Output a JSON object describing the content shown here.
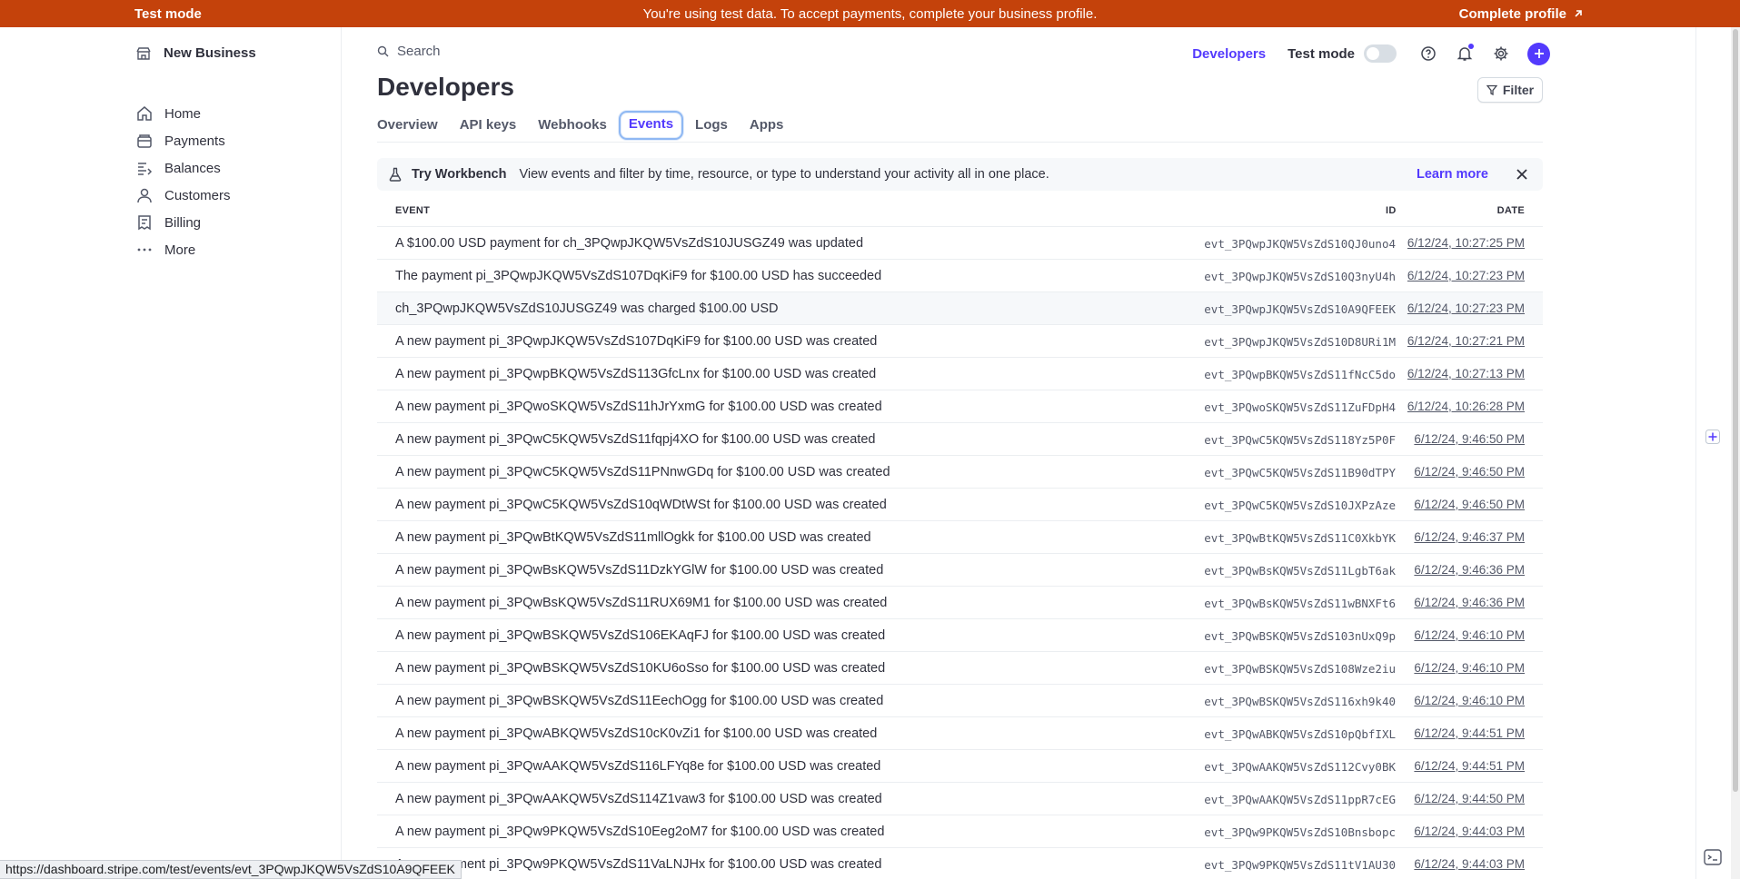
{
  "banner": {
    "left": "Test mode",
    "center": "You're using test data. To accept payments, complete your business profile.",
    "right": "Complete profile"
  },
  "sidebar": {
    "business": "New Business",
    "items": [
      {
        "label": "Home",
        "icon": "home-icon"
      },
      {
        "label": "Payments",
        "icon": "payments-icon"
      },
      {
        "label": "Balances",
        "icon": "balances-icon"
      },
      {
        "label": "Customers",
        "icon": "customers-icon"
      },
      {
        "label": "Billing",
        "icon": "billing-icon"
      },
      {
        "label": "More",
        "icon": "more-icon"
      }
    ]
  },
  "topbar": {
    "search_placeholder": "Search",
    "developers": "Developers",
    "test_mode": "Test mode"
  },
  "page": {
    "title": "Developers",
    "filter": "Filter",
    "tabs": [
      "Overview",
      "API keys",
      "Webhooks",
      "Events",
      "Logs",
      "Apps"
    ],
    "active_tab": "Events"
  },
  "notice": {
    "title": "Try Workbench",
    "text": "View events and filter by time, resource, or type to understand your activity all in one place.",
    "link": "Learn more"
  },
  "table": {
    "headers": {
      "event": "EVENT",
      "id": "ID",
      "date": "DATE"
    },
    "rows": [
      {
        "event": "A $100.00 USD payment for ch_3PQwpJKQW5VsZdS10JUSGZ49 was updated",
        "id": "evt_3PQwpJKQW5VsZdS10QJ0uno4",
        "date": "6/12/24, 10:27:25 PM"
      },
      {
        "event": "The payment pi_3PQwpJKQW5VsZdS107DqKiF9 for $100.00 USD has succeeded",
        "id": "evt_3PQwpJKQW5VsZdS10Q3nyU4h",
        "date": "6/12/24, 10:27:23 PM"
      },
      {
        "event": "ch_3PQwpJKQW5VsZdS10JUSGZ49 was charged $100.00 USD",
        "id": "evt_3PQwpJKQW5VsZdS10A9QFEEK",
        "date": "6/12/24, 10:27:23 PM"
      },
      {
        "event": "A new payment pi_3PQwpJKQW5VsZdS107DqKiF9 for $100.00 USD was created",
        "id": "evt_3PQwpJKQW5VsZdS10D8URi1M",
        "date": "6/12/24, 10:27:21 PM"
      },
      {
        "event": "A new payment pi_3PQwpBKQW5VsZdS113GfcLnx for $100.00 USD was created",
        "id": "evt_3PQwpBKQW5VsZdS11fNcC5do",
        "date": "6/12/24, 10:27:13 PM"
      },
      {
        "event": "A new payment pi_3PQwoSKQW5VsZdS11hJrYxmG for $100.00 USD was created",
        "id": "evt_3PQwoSKQW5VsZdS11ZuFDpH4",
        "date": "6/12/24, 10:26:28 PM"
      },
      {
        "event": "A new payment pi_3PQwC5KQW5VsZdS11fqpj4XO for $100.00 USD was created",
        "id": "evt_3PQwC5KQW5VsZdS118Yz5P0F",
        "date": "6/12/24, 9:46:50 PM"
      },
      {
        "event": "A new payment pi_3PQwC5KQW5VsZdS11PNnwGDq for $100.00 USD was created",
        "id": "evt_3PQwC5KQW5VsZdS11B90dTPY",
        "date": "6/12/24, 9:46:50 PM"
      },
      {
        "event": "A new payment pi_3PQwC5KQW5VsZdS10qWDtWSt for $100.00 USD was created",
        "id": "evt_3PQwC5KQW5VsZdS10JXPzAze",
        "date": "6/12/24, 9:46:50 PM"
      },
      {
        "event": "A new payment pi_3PQwBtKQW5VsZdS11mllOgkk for $100.00 USD was created",
        "id": "evt_3PQwBtKQW5VsZdS11C0XkbYK",
        "date": "6/12/24, 9:46:37 PM"
      },
      {
        "event": "A new payment pi_3PQwBsKQW5VsZdS11DzkYGlW for $100.00 USD was created",
        "id": "evt_3PQwBsKQW5VsZdS11LgbT6ak",
        "date": "6/12/24, 9:46:36 PM"
      },
      {
        "event": "A new payment pi_3PQwBsKQW5VsZdS11RUX69M1 for $100.00 USD was created",
        "id": "evt_3PQwBsKQW5VsZdS11wBNXFt6",
        "date": "6/12/24, 9:46:36 PM"
      },
      {
        "event": "A new payment pi_3PQwBSKQW5VsZdS106EKAqFJ for $100.00 USD was created",
        "id": "evt_3PQwBSKQW5VsZdS103nUxQ9p",
        "date": "6/12/24, 9:46:10 PM"
      },
      {
        "event": "A new payment pi_3PQwBSKQW5VsZdS10KU6oSso for $100.00 USD was created",
        "id": "evt_3PQwBSKQW5VsZdS108Wze2iu",
        "date": "6/12/24, 9:46:10 PM"
      },
      {
        "event": "A new payment pi_3PQwBSKQW5VsZdS11EechOgg for $100.00 USD was created",
        "id": "evt_3PQwBSKQW5VsZdS116xh9k40",
        "date": "6/12/24, 9:46:10 PM"
      },
      {
        "event": "A new payment pi_3PQwABKQW5VsZdS10cK0vZi1 for $100.00 USD was created",
        "id": "evt_3PQwABKQW5VsZdS10pQbfIXL",
        "date": "6/12/24, 9:44:51 PM"
      },
      {
        "event": "A new payment pi_3PQwAAKQW5VsZdS116LFYq8e for $100.00 USD was created",
        "id": "evt_3PQwAAKQW5VsZdS112Cvy0BK",
        "date": "6/12/24, 9:44:51 PM"
      },
      {
        "event": "A new payment pi_3PQwAAKQW5VsZdS114Z1vaw3 for $100.00 USD was created",
        "id": "evt_3PQwAAKQW5VsZdS11ppR7cEG",
        "date": "6/12/24, 9:44:50 PM"
      },
      {
        "event": "A new payment pi_3PQw9PKQW5VsZdS10Eeg2oM7 for $100.00 USD was created",
        "id": "evt_3PQw9PKQW5VsZdS10Bnsbopc",
        "date": "6/12/24, 9:44:03 PM"
      },
      {
        "event": "A new payment pi_3PQw9PKQW5VsZdS11VaLNJHx for $100.00 USD was created",
        "id": "evt_3PQw9PKQW5VsZdS11tV1AU30",
        "date": "6/12/24, 9:44:03 PM"
      }
    ],
    "hover_row": 2
  },
  "statusbar": {
    "url": "https://dashboard.stripe.com/test/events/evt_3PQwpJKQW5VsZdS10A9QFEEK"
  },
  "colors": {
    "banner": "#c4420b",
    "accent": "#533afd",
    "text": "#30313d"
  }
}
